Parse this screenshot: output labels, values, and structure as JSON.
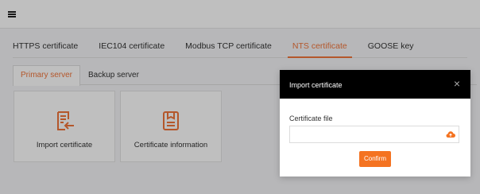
{
  "topbar": {
    "menu_icon": "hamburger-menu-icon"
  },
  "tabs": [
    {
      "label": "HTTPS certificate",
      "active": false
    },
    {
      "label": "IEC104 certificate",
      "active": false
    },
    {
      "label": "Modbus TCP certificate",
      "active": false
    },
    {
      "label": "NTS certificate",
      "active": true
    },
    {
      "label": "GOOSE key",
      "active": false
    }
  ],
  "subtabs": [
    {
      "label": "Primary server",
      "active": true
    },
    {
      "label": "Backup server",
      "active": false
    }
  ],
  "cards": [
    {
      "label": "Import certificate",
      "icon": "import-file-icon"
    },
    {
      "label": "Certificate information",
      "icon": "document-icon"
    }
  ],
  "modal": {
    "title": "Import certificate",
    "close_icon": "close-icon",
    "field_label": "Certificate file",
    "file_value": "",
    "upload_icon": "cloud-upload-icon",
    "confirm_label": "Confirm"
  },
  "colors": {
    "accent": "#f47321",
    "modal_header": "#000000"
  }
}
